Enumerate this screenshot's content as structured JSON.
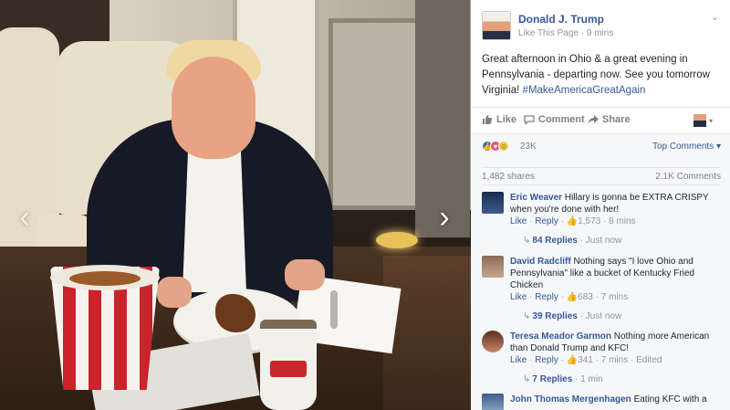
{
  "colors": {
    "facebook_blue": "#365899",
    "meta_gray": "#90949c",
    "text_dark": "#1d2129",
    "feedback_bg": "#f6f7f9"
  },
  "photo": {
    "prev_arrow": "‹",
    "next_arrow": "›",
    "prev_icon": "chevron-left-icon",
    "next_icon": "chevron-right-icon"
  },
  "post": {
    "author": "Donald J. Trump",
    "like_page": "Like This Page",
    "time": "9 mins",
    "text_main": "Great afternoon in Ohio & a great evening in Pennsylvania - departing now. See you tomorrow Virginia! ",
    "hashtag": "#MakeAmericaGreatAgain"
  },
  "actions": {
    "like": "Like",
    "comment": "Comment",
    "share": "Share"
  },
  "feedback": {
    "reaction_count": "23K",
    "top_comments": "Top Comments",
    "shares": "1,482 shares",
    "comments_count": "2.1K Comments"
  },
  "comments": [
    {
      "name": "Eric Weaver",
      "text": "Hillary is gonna be EXTRA CRISPY when you're done with her!",
      "like": "Like",
      "reply": "Reply",
      "likes": "1,573",
      "time": "8 mins",
      "edited": "",
      "replies": "84 Replies",
      "replies_time": "Just now"
    },
    {
      "name": "David Radcliff",
      "text": "Nothing says \"I love Ohio and Pennsylvania\" like a bucket of Kentucky Fried Chicken",
      "like": "Like",
      "reply": "Reply",
      "likes": "683",
      "time": "7 mins",
      "edited": "",
      "replies": "39 Replies",
      "replies_time": "Just now"
    },
    {
      "name": "Teresa Meador Garmon",
      "text": "Nothing more American than Donald Trump and KFC!",
      "like": "Like",
      "reply": "Reply",
      "likes": "341",
      "time": "7 mins",
      "edited": "Edited",
      "replies": "7 Replies",
      "replies_time": "1 min"
    },
    {
      "name": "John Thomas Mergenhagen",
      "text": "Eating KFC with a",
      "like": "",
      "reply": "",
      "likes": "",
      "time": "",
      "edited": "",
      "replies": "",
      "replies_time": ""
    }
  ]
}
